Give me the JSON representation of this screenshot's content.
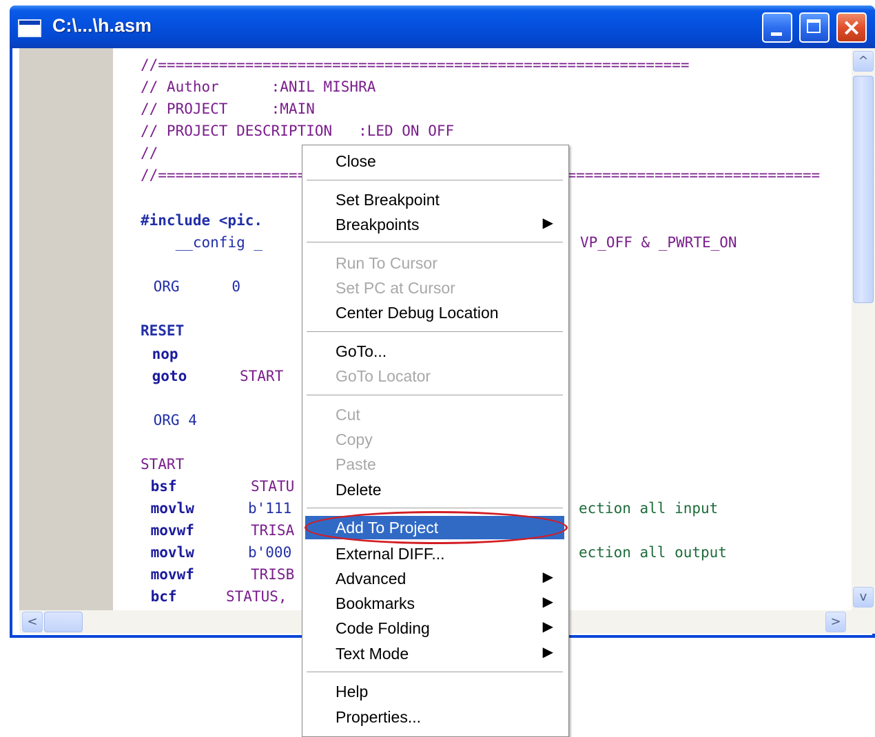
{
  "window": {
    "title": "C:\\...\\h.asm",
    "buttons": {
      "minimize": "minimize",
      "maximize": "maximize",
      "close": "×"
    }
  },
  "editor": {
    "lines": [
      {
        "text": "//=============================================================",
        "color": "comment"
      },
      {
        "text": "// Author      :ANIL MISHRA",
        "color": "comment"
      },
      {
        "text": "// PROJECT     :MAIN",
        "color": "comment"
      },
      {
        "text": "// PROJECT DESCRIPTION   :LED ON OFF",
        "color": "comment"
      },
      {
        "text": "//",
        "color": "comment"
      },
      {
        "text": "//============================================================================",
        "color": "comment"
      },
      {
        "text": "#include <pic.",
        "color": "directive"
      },
      {
        "text": "    __config _",
        "color": "blue"
      },
      {
        "text": "VP_OFF & _PWRTE_ON",
        "color": "purple"
      },
      {
        "text": " ORG      0",
        "color": "blue"
      },
      {
        "text": "RESET",
        "color": "directive"
      },
      {
        "text": " nop",
        "color": "kw"
      },
      {
        "text": " goto",
        "color": "kw"
      },
      {
        "text": "START",
        "color": "purple"
      },
      {
        "text": " ORG 4",
        "color": "blue"
      },
      {
        "text": "START",
        "color": "purple"
      },
      {
        "text": " bsf",
        "color": "kw"
      },
      {
        "text": "STATU",
        "color": "purple"
      },
      {
        "text": " movlw",
        "color": "kw"
      },
      {
        "text": "b'111",
        "color": "blue"
      },
      {
        "text": "ection all input",
        "color": "green"
      },
      {
        "text": " movwf",
        "color": "kw"
      },
      {
        "text": "TRISA",
        "color": "purple"
      },
      {
        "text": " movlw",
        "color": "kw"
      },
      {
        "text": "b'000",
        "color": "blue"
      },
      {
        "text": "ection all output",
        "color": "green"
      },
      {
        "text": " movwf",
        "color": "kw"
      },
      {
        "text": "TRISB",
        "color": "purple"
      },
      {
        "text": " bcf",
        "color": "kw"
      },
      {
        "text": "STATUS,",
        "color": "purple"
      }
    ]
  },
  "scrollbars": {
    "up": "^",
    "down": "v",
    "left": "<",
    "right": ">"
  },
  "context_menu": {
    "items": [
      {
        "label": "Close",
        "enabled": true
      },
      {
        "label": "Set Breakpoint",
        "enabled": true
      },
      {
        "label": "Breakpoints",
        "enabled": true,
        "submenu": true
      },
      {
        "label": "Run To Cursor",
        "enabled": false
      },
      {
        "label": "Set PC at Cursor",
        "enabled": false
      },
      {
        "label": "Center Debug Location",
        "enabled": true
      },
      {
        "label": "GoTo...",
        "enabled": true
      },
      {
        "label": "GoTo Locator",
        "enabled": false
      },
      {
        "label": "Cut",
        "enabled": false
      },
      {
        "label": "Copy",
        "enabled": false
      },
      {
        "label": "Paste",
        "enabled": false
      },
      {
        "label": "Delete",
        "enabled": true
      },
      {
        "label": "Add To Project",
        "enabled": true,
        "highlighted": true
      },
      {
        "label": "External DIFF...",
        "enabled": true
      },
      {
        "label": "Advanced",
        "enabled": true,
        "submenu": true
      },
      {
        "label": "Bookmarks",
        "enabled": true,
        "submenu": true
      },
      {
        "label": "Code Folding",
        "enabled": true,
        "submenu": true
      },
      {
        "label": "Text Mode",
        "enabled": true,
        "submenu": true
      },
      {
        "label": "Help",
        "enabled": true
      },
      {
        "label": "Properties...",
        "enabled": true
      }
    ],
    "submenu_arrow": "▶"
  },
  "colors": {
    "comment": "#7a1d8c",
    "directive": "#222fa8",
    "keyword": "#1a1a9e",
    "green_comment": "#1d6b3a",
    "highlight": "#316ac5",
    "annotation": "#d21d24"
  }
}
